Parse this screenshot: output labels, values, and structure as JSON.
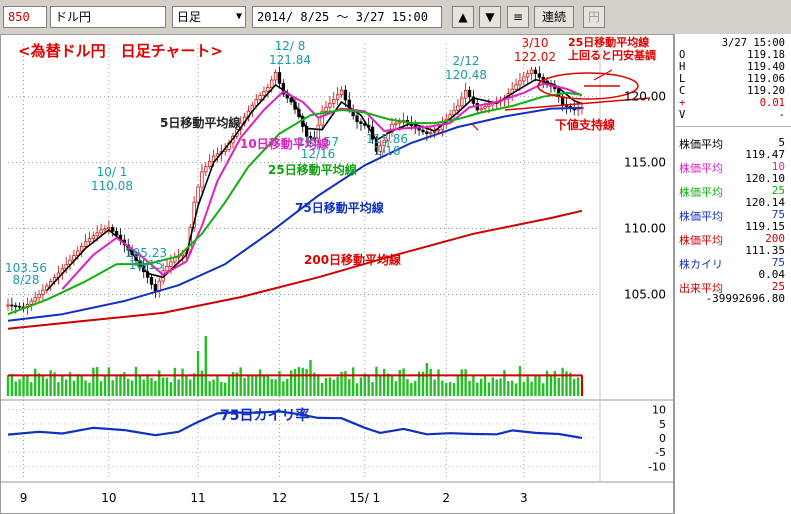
{
  "toolbar": {
    "code": "850",
    "name": "ドル円",
    "period": "日足",
    "range_start": "2014/ 8/25",
    "range_sep": "～",
    "range_end": "3/27 15:00",
    "btn_up": "▲",
    "btn_down": "▼",
    "btn_menu": "≡",
    "btn_continuous": "連続",
    "btn_yen": "円"
  },
  "quote": {
    "time": "3/27 15:00",
    "rows": [
      {
        "k": "O",
        "v": "119.18"
      },
      {
        "k": "H",
        "v": "119.40"
      },
      {
        "k": "L",
        "v": "119.06"
      },
      {
        "k": "C",
        "v": "119.20"
      },
      {
        "k": "+",
        "v": "0.01"
      },
      {
        "k": "V",
        "v": "-"
      }
    ]
  },
  "indicators": [
    {
      "label": "株価平均",
      "param": "5",
      "value": "119.47",
      "color": "#000000"
    },
    {
      "label": "株価平均",
      "param": "10",
      "value": "120.10",
      "color": "#e020c0"
    },
    {
      "label": "株価平均",
      "param": "25",
      "value": "120.14",
      "color": "#10b010"
    },
    {
      "label": "株価平均",
      "param": "75",
      "value": "119.15",
      "color": "#1030c0"
    },
    {
      "label": "株価平均",
      "param": "200",
      "value": "111.35",
      "color": "#cc0000"
    },
    {
      "label": "株カイリ",
      "param": "75",
      "value": "0.04",
      "color": "#1030c0"
    },
    {
      "label": "出来平均",
      "param": "25",
      "value": "-39992696.80",
      "color": "#cc0000"
    }
  ],
  "chart_data": {
    "type": "line",
    "title": "<為替ドル円　日足チャート>",
    "x_ticks": [
      {
        "label": "9",
        "idx": 4
      },
      {
        "label": "10",
        "idx": 26
      },
      {
        "label": "11",
        "idx": 49
      },
      {
        "label": "12",
        "idx": 70
      },
      {
        "label": "15/ 1",
        "idx": 92
      },
      {
        "label": "2",
        "idx": 113
      },
      {
        "label": "3",
        "idx": 133
      }
    ],
    "y_ticks": [
      "105.00",
      "110.00",
      "115.00",
      "120.00"
    ],
    "ylim": [
      102,
      124
    ],
    "price_points": [
      [
        0,
        104.2
      ],
      [
        4,
        104.0
      ],
      [
        8,
        105.0
      ],
      [
        12,
        106.3
      ],
      [
        16,
        107.6
      ],
      [
        20,
        109.0
      ],
      [
        24,
        109.9
      ],
      [
        26,
        110.08
      ],
      [
        28,
        109.5
      ],
      [
        32,
        108.0
      ],
      [
        36,
        106.3
      ],
      [
        38,
        105.23
      ],
      [
        40,
        106.8
      ],
      [
        43,
        107.8
      ],
      [
        46,
        108.2
      ],
      [
        48,
        112.0
      ],
      [
        50,
        114.3
      ],
      [
        53,
        115.5
      ],
      [
        56,
        116.0
      ],
      [
        60,
        118.0
      ],
      [
        64,
        119.8
      ],
      [
        67,
        120.7
      ],
      [
        69,
        121.84
      ],
      [
        71,
        120.2
      ],
      [
        73,
        119.6
      ],
      [
        75,
        118.5
      ],
      [
        77,
        117.0
      ],
      [
        79,
        116.8
      ],
      [
        81,
        118.9
      ],
      [
        84,
        119.8
      ],
      [
        86,
        120.5
      ],
      [
        88,
        119.0
      ],
      [
        90,
        118.1
      ],
      [
        93,
        117.7
      ],
      [
        95,
        115.86
      ],
      [
        97,
        116.7
      ],
      [
        99,
        117.9
      ],
      [
        102,
        118.2
      ],
      [
        105,
        117.6
      ],
      [
        108,
        117.2
      ],
      [
        111,
        117.5
      ],
      [
        113,
        118.3
      ],
      [
        116,
        119.3
      ],
      [
        118,
        120.48
      ],
      [
        121,
        119.0
      ],
      [
        125,
        119.5
      ],
      [
        128,
        119.9
      ],
      [
        131,
        120.9
      ],
      [
        133,
        121.5
      ],
      [
        135,
        122.02
      ],
      [
        138,
        121.2
      ],
      [
        141,
        120.6
      ],
      [
        143,
        119.4
      ],
      [
        146,
        119.0
      ],
      [
        148,
        119.2
      ]
    ],
    "series": [
      {
        "name": "5日移動平均線",
        "color": "#000000",
        "points": [
          [
            10,
            105.3
          ],
          [
            20,
            108.5
          ],
          [
            26,
            109.9
          ],
          [
            30,
            108.9
          ],
          [
            36,
            106.6
          ],
          [
            40,
            106.3
          ],
          [
            46,
            108.0
          ],
          [
            49,
            111.7
          ],
          [
            53,
            115.0
          ],
          [
            58,
            116.8
          ],
          [
            63,
            118.9
          ],
          [
            69,
            120.9
          ],
          [
            73,
            120.1
          ],
          [
            77,
            117.6
          ],
          [
            81,
            117.5
          ],
          [
            86,
            119.6
          ],
          [
            91,
            118.6
          ],
          [
            95,
            116.7
          ],
          [
            99,
            117.4
          ],
          [
            104,
            118.0
          ],
          [
            110,
            117.4
          ],
          [
            116,
            118.8
          ],
          [
            120,
            119.9
          ],
          [
            126,
            119.5
          ],
          [
            132,
            120.6
          ],
          [
            136,
            121.3
          ],
          [
            141,
            120.9
          ],
          [
            146,
            119.7
          ],
          [
            148,
            119.47
          ]
        ]
      },
      {
        "name": "10日移動平均線",
        "color": "#e020c0",
        "points": [
          [
            14,
            105.4
          ],
          [
            22,
            108.0
          ],
          [
            28,
            109.3
          ],
          [
            34,
            108.0
          ],
          [
            40,
            106.5
          ],
          [
            46,
            107.5
          ],
          [
            50,
            110.2
          ],
          [
            54,
            113.6
          ],
          [
            60,
            116.9
          ],
          [
            66,
            119.0
          ],
          [
            71,
            120.4
          ],
          [
            76,
            119.6
          ],
          [
            80,
            118.4
          ],
          [
            86,
            119.1
          ],
          [
            92,
            118.9
          ],
          [
            97,
            117.4
          ],
          [
            102,
            117.6
          ],
          [
            108,
            117.7
          ],
          [
            114,
            118.0
          ],
          [
            119,
            119.2
          ],
          [
            126,
            119.6
          ],
          [
            133,
            120.3
          ],
          [
            138,
            121.0
          ],
          [
            144,
            120.6
          ],
          [
            148,
            120.1
          ]
        ]
      },
      {
        "name": "25日移動平均線",
        "color": "#10b010",
        "points": [
          [
            0,
            103.5
          ],
          [
            10,
            104.6
          ],
          [
            20,
            106.0
          ],
          [
            28,
            107.3
          ],
          [
            36,
            107.3
          ],
          [
            44,
            107.9
          ],
          [
            50,
            109.6
          ],
          [
            56,
            112.0
          ],
          [
            62,
            114.7
          ],
          [
            70,
            117.2
          ],
          [
            78,
            118.6
          ],
          [
            86,
            119.0
          ],
          [
            92,
            118.8
          ],
          [
            98,
            118.3
          ],
          [
            104,
            118.0
          ],
          [
            110,
            118.0
          ],
          [
            116,
            118.3
          ],
          [
            122,
            118.8
          ],
          [
            130,
            119.3
          ],
          [
            138,
            120.0
          ],
          [
            144,
            120.3
          ],
          [
            148,
            120.14
          ]
        ]
      },
      {
        "name": "75日移動平均線",
        "color": "#1030c0",
        "points": [
          [
            0,
            103.0
          ],
          [
            14,
            103.5
          ],
          [
            30,
            104.5
          ],
          [
            44,
            105.7
          ],
          [
            56,
            107.3
          ],
          [
            68,
            109.8
          ],
          [
            80,
            112.5
          ],
          [
            92,
            114.8
          ],
          [
            104,
            116.5
          ],
          [
            116,
            117.7
          ],
          [
            128,
            118.5
          ],
          [
            140,
            119.1
          ],
          [
            148,
            119.15
          ]
        ]
      },
      {
        "name": "200日移動平均線",
        "color": "#cc0000",
        "points": [
          [
            0,
            102.4
          ],
          [
            20,
            103.0
          ],
          [
            40,
            103.6
          ],
          [
            60,
            104.8
          ],
          [
            80,
            106.3
          ],
          [
            100,
            108.0
          ],
          [
            120,
            109.6
          ],
          [
            140,
            110.8
          ],
          [
            148,
            111.35
          ]
        ]
      }
    ],
    "labels": {
      "a_high1": "10/ 1\n110.08",
      "a_low1": "105.23\n10/15",
      "a_high2": "12/ 8\n121.84",
      "a_low2": "115.57\n12/16",
      "a_low3": "115.86\n1/16",
      "a_high3": "2/12\n120.48",
      "a_high4": "3/10\n122.02",
      "a_start": "103.56\n8/28",
      "ma5": "5日移動平均線",
      "ma10": "10日移動平均線",
      "ma25": "25日移動平均線",
      "ma75": "75日移動平均線",
      "ma200": "200日移動平均線",
      "note1": "25日移動平均線\n上回ると円安基調",
      "note2": "下値支持線",
      "kairi": "75日カイリ率"
    },
    "volume": [
      {
        "from": 0,
        "to": 148,
        "base_frac": 0.35
      },
      {
        "spikes": [
          [
            49,
            0.75
          ],
          [
            51,
            1.0
          ],
          [
            78,
            0.6
          ],
          [
            108,
            0.55
          ],
          [
            132,
            0.5
          ]
        ]
      }
    ],
    "kairi_points": [
      [
        0,
        1.2
      ],
      [
        8,
        2.2
      ],
      [
        14,
        1.6
      ],
      [
        22,
        3.6
      ],
      [
        30,
        2.8
      ],
      [
        38,
        1.0
      ],
      [
        44,
        2.2
      ],
      [
        48,
        5.0
      ],
      [
        54,
        8.7
      ],
      [
        58,
        9.0
      ],
      [
        64,
        8.9
      ],
      [
        70,
        9.4
      ],
      [
        74,
        8.6
      ],
      [
        80,
        7.1
      ],
      [
        86,
        7.0
      ],
      [
        92,
        3.6
      ],
      [
        96,
        1.8
      ],
      [
        102,
        3.2
      ],
      [
        108,
        1.3
      ],
      [
        114,
        1.7
      ],
      [
        120,
        1.4
      ],
      [
        126,
        1.3
      ],
      [
        130,
        2.7
      ],
      [
        136,
        1.8
      ],
      [
        142,
        1.4
      ],
      [
        148,
        0.04
      ]
    ],
    "kairi_ylim": [
      -12,
      12
    ],
    "kairi_ticks": [
      "10",
      "5",
      "0",
      "-5",
      "-10"
    ]
  }
}
